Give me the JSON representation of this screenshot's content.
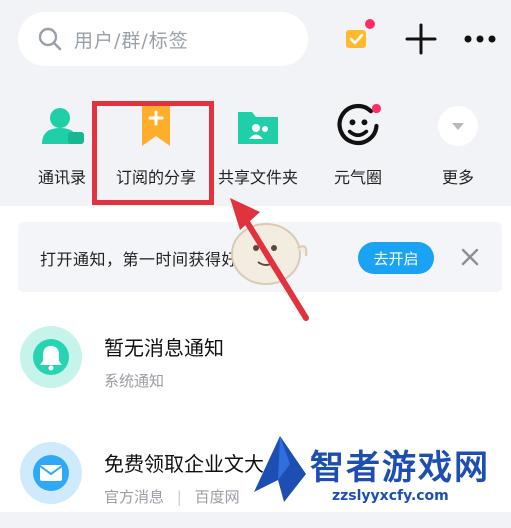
{
  "search": {
    "placeholder": "用户/群/标签"
  },
  "top_actions": {
    "icons": [
      "search-icon",
      "checklist-icon",
      "plus-icon",
      "more-icon"
    ],
    "badge_color": "#ff2e6a"
  },
  "apps": [
    {
      "label": "通讯录",
      "icon": "contacts-icon"
    },
    {
      "label": "订阅的分享",
      "icon": "bookmark-icon"
    },
    {
      "label": "共享文件夹",
      "icon": "shared-folder-icon"
    },
    {
      "label": "元气圈",
      "icon": "smile-circle-icon"
    },
    {
      "label": "更多",
      "icon": "chevron-down-icon"
    }
  ],
  "notice": {
    "text": "打开通知，第一时间获得好资源",
    "button_label": "去开启",
    "close_icon": "close-icon"
  },
  "messages": [
    {
      "title": "暂无消息通知",
      "subtitle": "系统通知",
      "icon": "bell-icon",
      "color": "#26d4b4"
    },
    {
      "title": "免费领取企业文",
      "title_tail": "大",
      "subtitle_a": "官方消息",
      "subtitle_b": "百度网",
      "icon": "mail-icon",
      "color": "#2fa8f5"
    }
  ],
  "watermark": {
    "text": "智者游戏网",
    "url": "zzslyyxcfy.com"
  },
  "colors": {
    "accent_blue": "#1aa3f5",
    "highlight_red": "#e0333e",
    "teal": "#26d4b4",
    "orange": "#ffae2b"
  }
}
